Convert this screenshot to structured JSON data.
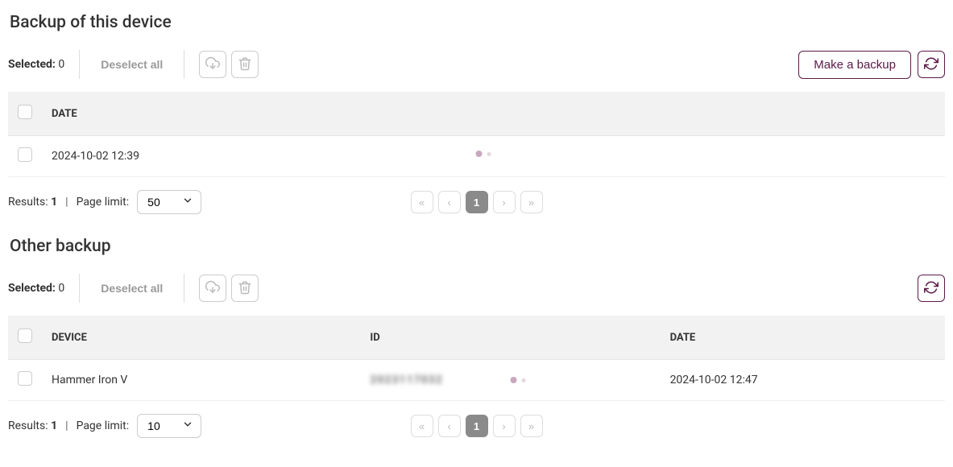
{
  "device_backup": {
    "title": "Backup of this device",
    "selected_label": "Selected:",
    "selected_count": "0",
    "deselect_label": "Deselect all",
    "make_backup_label": "Make a backup",
    "headers": {
      "date": "DATE"
    },
    "rows": [
      {
        "date": "2024-10-02 12:39"
      }
    ],
    "footer": {
      "results_label": "Results:",
      "results_count": "1",
      "page_limit_label": "Page limit:",
      "page_limit_value": "50",
      "current_page": "1"
    }
  },
  "other_backup": {
    "title": "Other backup",
    "selected_label": "Selected:",
    "selected_count": "0",
    "deselect_label": "Deselect all",
    "headers": {
      "device": "DEVICE",
      "id": "ID",
      "date": "DATE"
    },
    "rows": [
      {
        "device": "Hammer Iron V",
        "id": "2023117032",
        "date": "2024-10-02 12:47"
      }
    ],
    "footer": {
      "results_label": "Results:",
      "results_count": "1",
      "page_limit_label": "Page limit:",
      "page_limit_value": "10",
      "current_page": "1"
    }
  }
}
